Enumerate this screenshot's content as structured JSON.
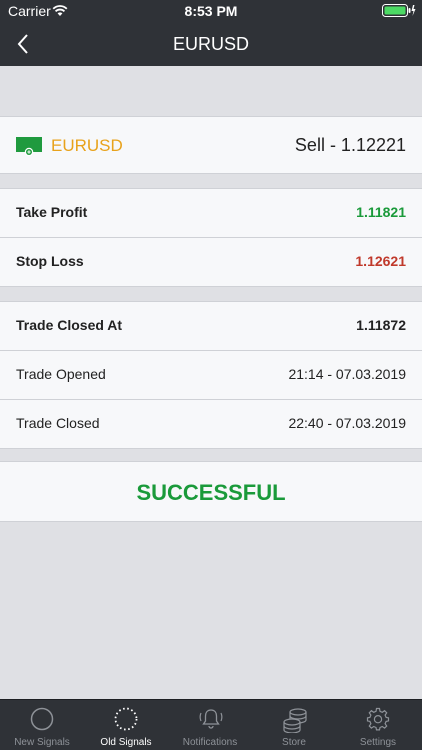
{
  "status_bar": {
    "carrier": "Carrier",
    "time": "8:53 PM"
  },
  "nav": {
    "title": "EURUSD"
  },
  "pair": {
    "name": "EURUSD",
    "side_price": "Sell - 1.12221"
  },
  "targets": [
    {
      "label": "Take Profit",
      "value": "1.11821",
      "color": "#1a9a3a"
    },
    {
      "label": "Stop Loss",
      "value": "1.12621",
      "color": "#c0392b"
    }
  ],
  "trade": [
    {
      "label": "Trade Closed At",
      "value": "1.11872"
    },
    {
      "label": "Trade Opened",
      "value": "21:14 - 07.03.2019"
    },
    {
      "label": "Trade Closed",
      "value": "22:40 - 07.03.2019"
    }
  ],
  "result": {
    "text": "SUCCESSFUL",
    "color": "#1a9a3a"
  },
  "tabs": [
    {
      "label": "New Signals",
      "icon": "circle-icon"
    },
    {
      "label": "Old Signals",
      "icon": "dotted-circle-icon",
      "active": true
    },
    {
      "label": "Notifications",
      "icon": "bell-icon"
    },
    {
      "label": "Store",
      "icon": "coins-icon"
    },
    {
      "label": "Settings",
      "icon": "gear-icon"
    }
  ]
}
